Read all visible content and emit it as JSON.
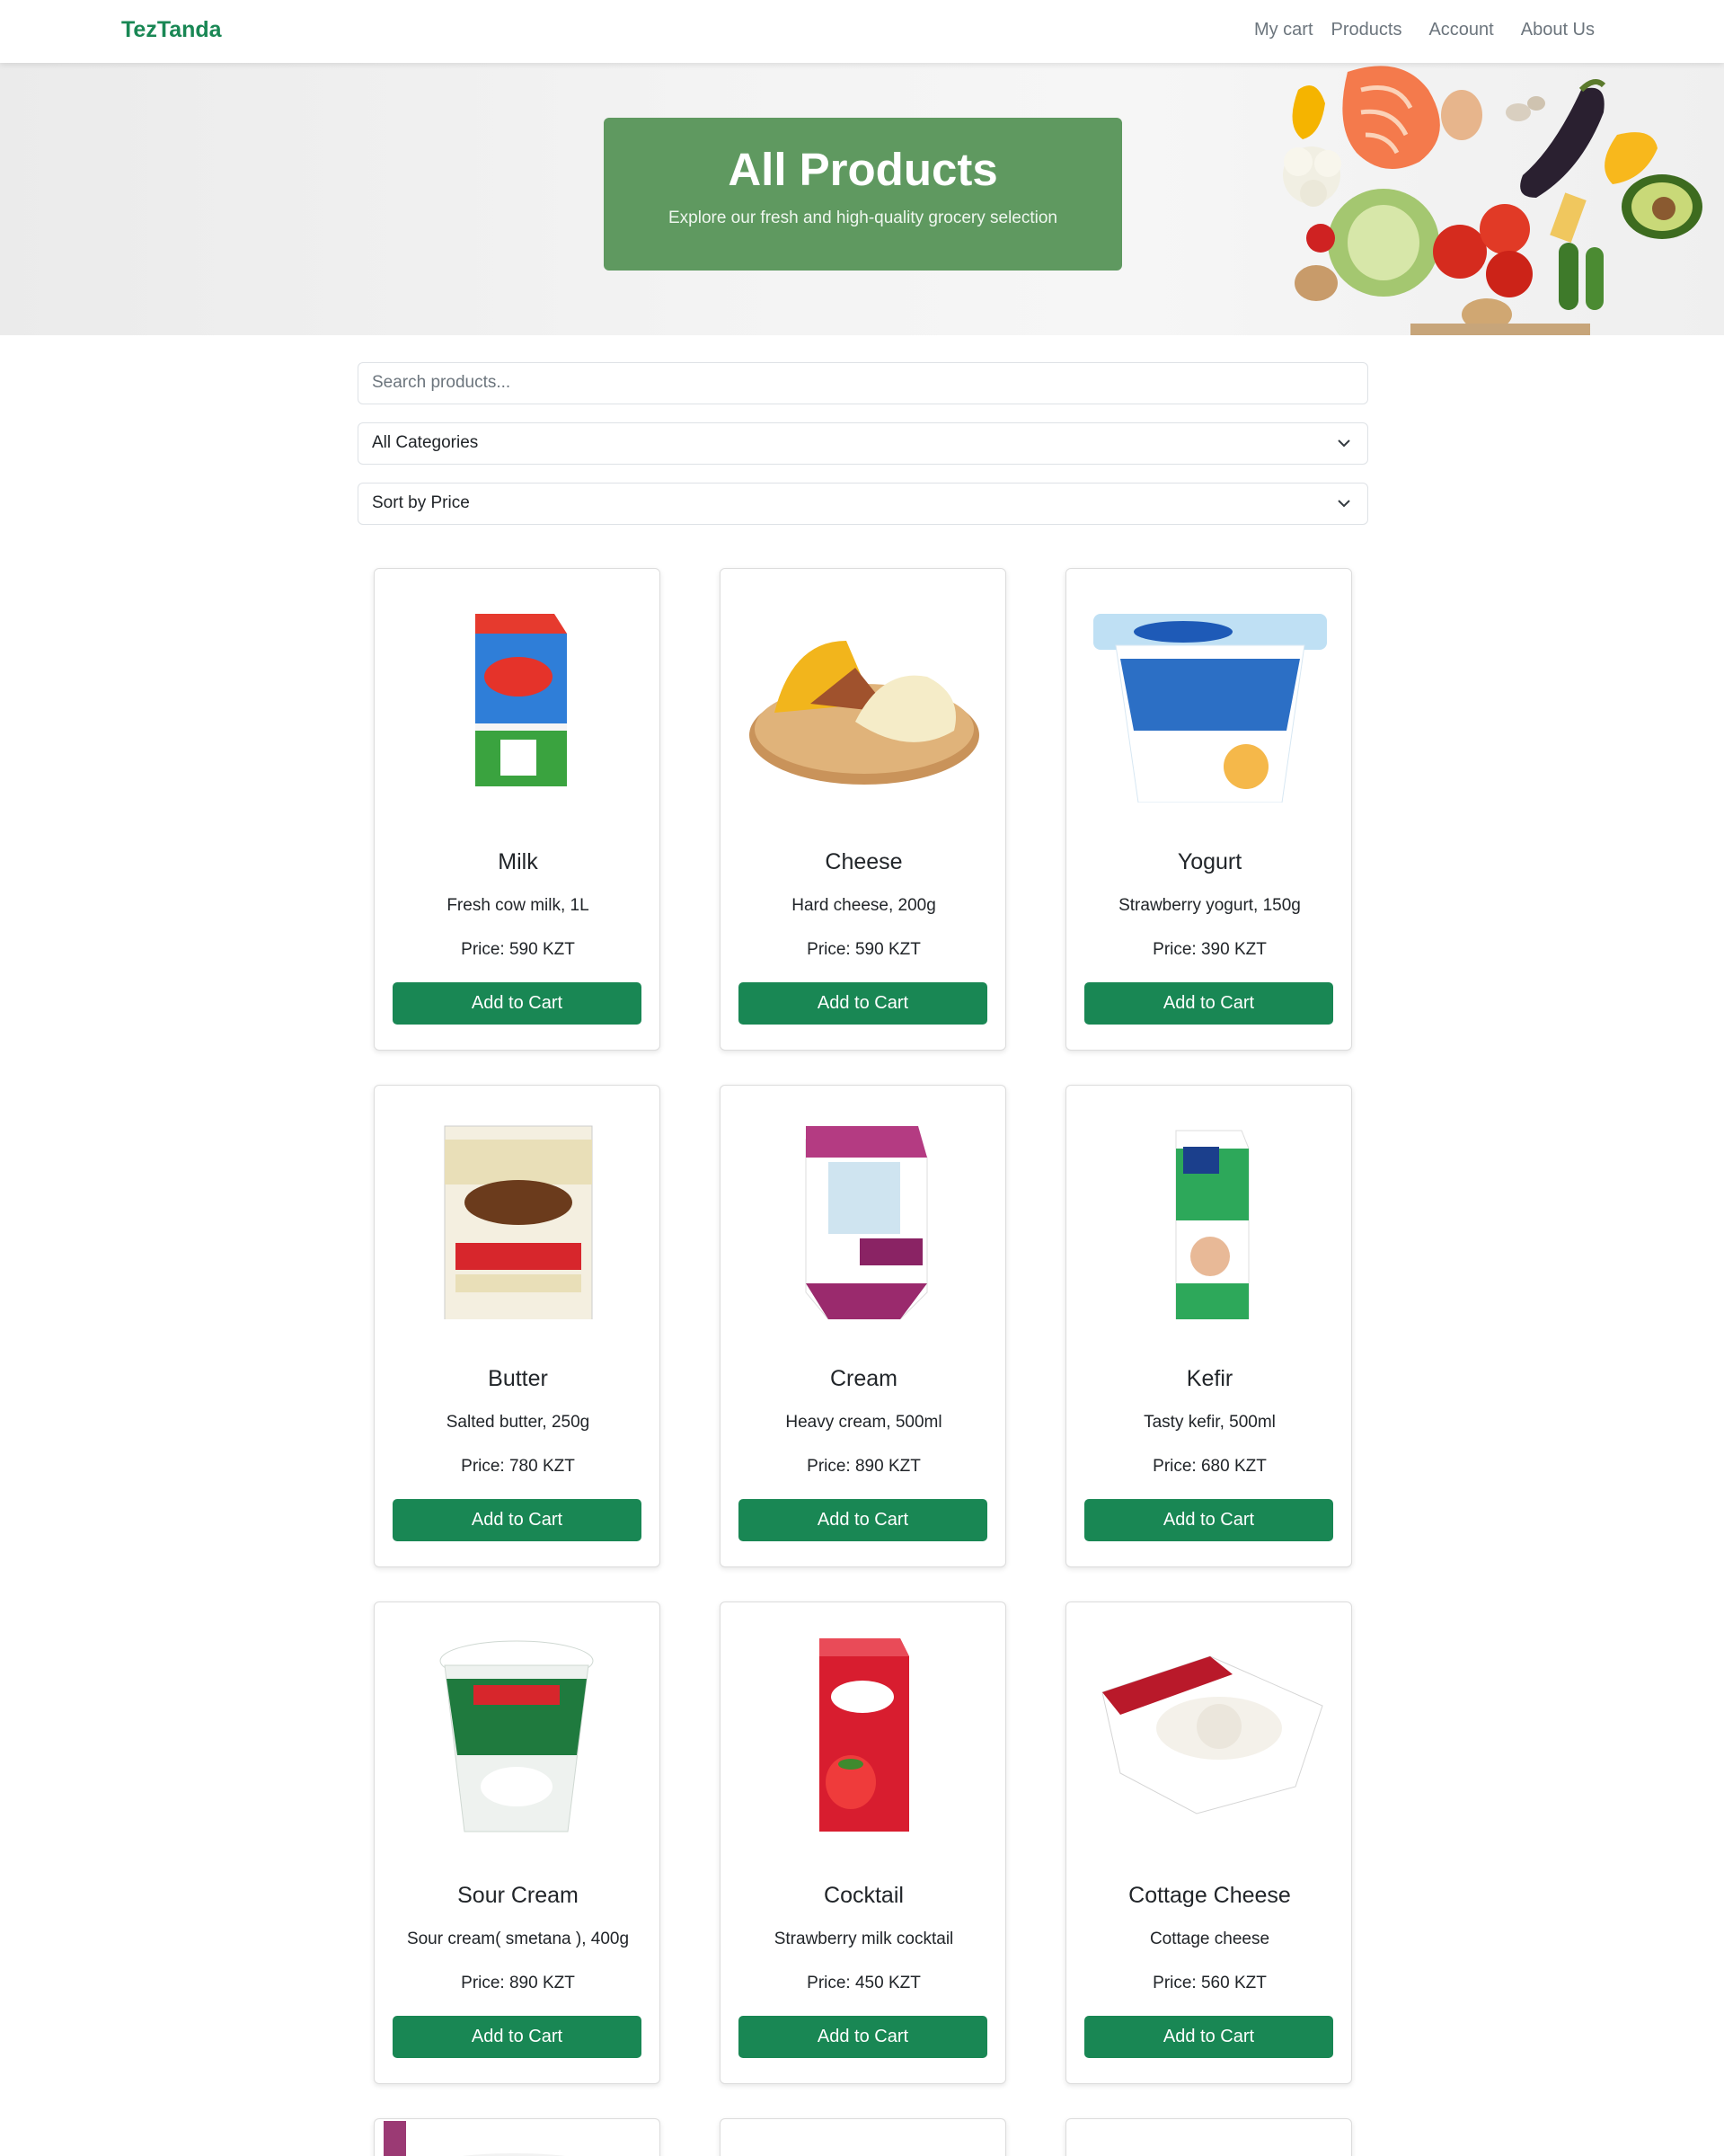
{
  "nav": {
    "brand": "TezTanda",
    "links": [
      "My cart",
      "Products",
      "Account",
      "About Us"
    ]
  },
  "hero": {
    "title": "All Products",
    "subtitle": "Explore our fresh and high-quality grocery selection"
  },
  "filters": {
    "search_placeholder": "Search products...",
    "category_selected": "All Categories",
    "sort_selected": "Sort by Price"
  },
  "products": [
    {
      "name": "Milk",
      "desc": "Fresh cow milk, 1L",
      "price": "Price: 590 KZT",
      "button": "Add to Cart"
    },
    {
      "name": "Cheese",
      "desc": "Hard cheese, 200g",
      "price": "Price: 590 KZT",
      "button": "Add to Cart"
    },
    {
      "name": "Yogurt",
      "desc": "Strawberry yogurt, 150g",
      "price": "Price: 390 KZT",
      "button": "Add to Cart"
    },
    {
      "name": "Butter",
      "desc": "Salted butter, 250g",
      "price": "Price: 780 KZT",
      "button": "Add to Cart"
    },
    {
      "name": "Cream",
      "desc": "Heavy cream, 500ml",
      "price": "Price: 890 KZT",
      "button": "Add to Cart"
    },
    {
      "name": "Kefir",
      "desc": "Tasty kefir, 500ml",
      "price": "Price: 680 KZT",
      "button": "Add to Cart"
    },
    {
      "name": "Sour Cream",
      "desc": "Sour cream( smetana ), 400g",
      "price": "Price: 890 KZT",
      "button": "Add to Cart"
    },
    {
      "name": "Cocktail",
      "desc": "Strawberry milk cocktail",
      "price": "Price: 450 KZT",
      "button": "Add to Cart"
    },
    {
      "name": "Cottage Cheese",
      "desc": "Cottage cheese",
      "price": "Price: 560 KZT",
      "button": "Add to Cart"
    }
  ],
  "colors": {
    "brand": "#198754",
    "hero_box": "#5f9960",
    "button": "#198754"
  }
}
